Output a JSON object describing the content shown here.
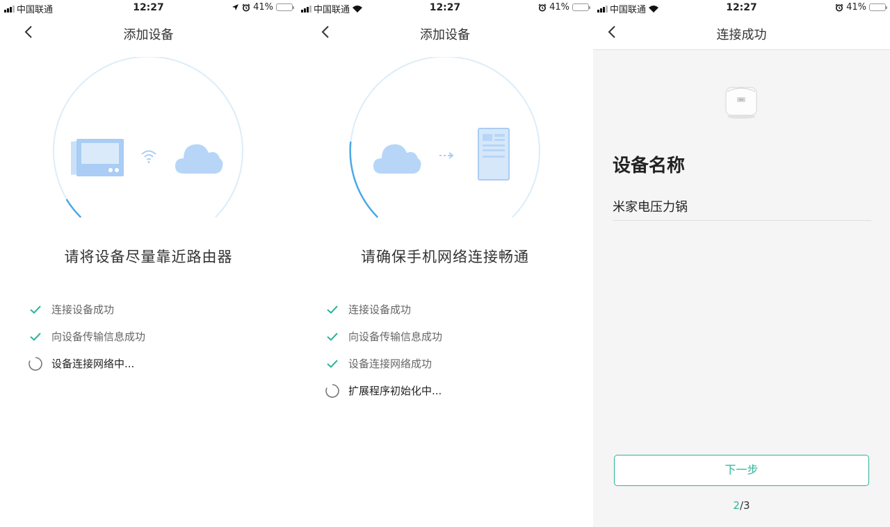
{
  "status": {
    "carrier": "中国联通",
    "time": "12:27",
    "battery": "41%",
    "battery_level": 0.41,
    "battery_color": "#f5c400"
  },
  "screens": [
    {
      "title": "添加设备",
      "headline": "请将设备尽量靠近路由器",
      "illustration": [
        "device-panel-icon",
        "wifi-icon",
        "cloud-icon"
      ],
      "steps": [
        {
          "label": "连接设备成功",
          "state": "done"
        },
        {
          "label": "向设备传输信息成功",
          "state": "done"
        },
        {
          "label": "设备连接网络中...",
          "state": "pending"
        }
      ]
    },
    {
      "title": "添加设备",
      "headline": "请确保手机网络连接畅通",
      "illustration": [
        "cloud-icon",
        "arrow-icon",
        "phone-icon"
      ],
      "steps": [
        {
          "label": "连接设备成功",
          "state": "done"
        },
        {
          "label": "向设备传输信息成功",
          "state": "done"
        },
        {
          "label": "设备连接网络成功",
          "state": "done"
        },
        {
          "label": "扩展程序初始化中...",
          "state": "pending"
        }
      ]
    },
    {
      "title": "连接成功",
      "device_icon": "rice-cooker-icon",
      "name_heading": "设备名称",
      "device_name": "米家电压力锅",
      "next_button": "下一步",
      "page_current": "2",
      "page_total": "/3"
    }
  ],
  "colors": {
    "accent": "#2bb39a",
    "progress_arc": "#4aa8e6",
    "ring": "#dcedf8",
    "illustration": "#bcd9f7"
  }
}
